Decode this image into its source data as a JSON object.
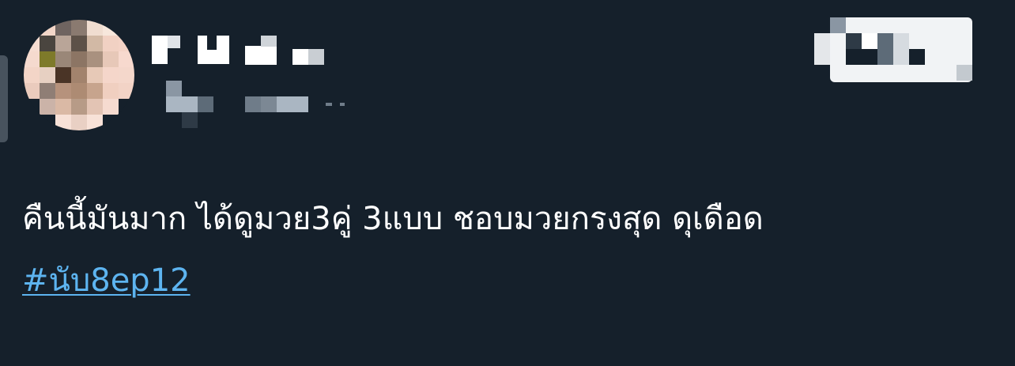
{
  "tweet": {
    "text": "คืนนี้มันมาก ได้ดูมวย3คู่ 3แบบ ชอบมวยกรงสุด ดุเดือด",
    "hashtag": "#นับ8ep12"
  },
  "colors": {
    "background": "#15202b",
    "text": "#ffffff",
    "link": "#5db4f0"
  }
}
